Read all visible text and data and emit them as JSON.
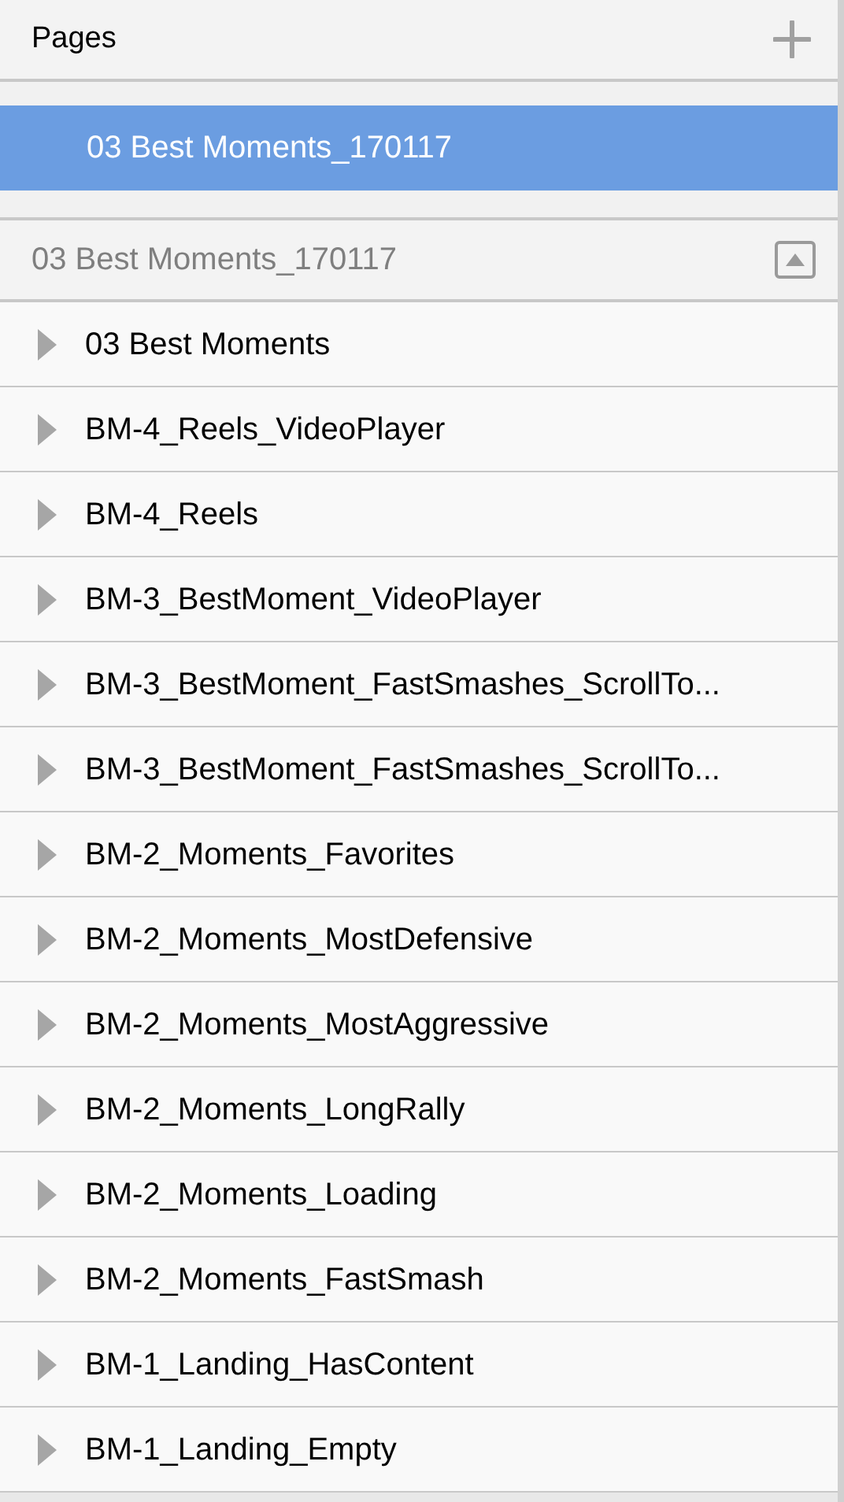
{
  "header": {
    "title": "Pages"
  },
  "pages": [
    {
      "name": "03 Best Moments_170117",
      "selected": true
    }
  ],
  "layers": {
    "title": "03 Best Moments_170117",
    "items": [
      {
        "name": "03 Best Moments",
        "expanded": false
      },
      {
        "name": "BM-4_Reels_VideoPlayer",
        "expanded": false
      },
      {
        "name": "BM-4_Reels",
        "expanded": false
      },
      {
        "name": "BM-3_BestMoment_VideoPlayer",
        "expanded": false
      },
      {
        "name": "BM-3_BestMoment_FastSmashes_ScrollTo...",
        "expanded": false
      },
      {
        "name": "BM-3_BestMoment_FastSmashes_ScrollTo...",
        "expanded": false
      },
      {
        "name": "BM-2_Moments_Favorites",
        "expanded": false
      },
      {
        "name": "BM-2_Moments_MostDefensive",
        "expanded": false
      },
      {
        "name": "BM-2_Moments_MostAggressive",
        "expanded": false
      },
      {
        "name": "BM-2_Moments_LongRally",
        "expanded": false
      },
      {
        "name": "BM-2_Moments_Loading",
        "expanded": false
      },
      {
        "name": "BM-2_Moments_FastSmash",
        "expanded": false
      },
      {
        "name": "BM-1_Landing_HasContent",
        "expanded": false
      },
      {
        "name": "BM-1_Landing_Empty",
        "expanded": false
      }
    ]
  }
}
